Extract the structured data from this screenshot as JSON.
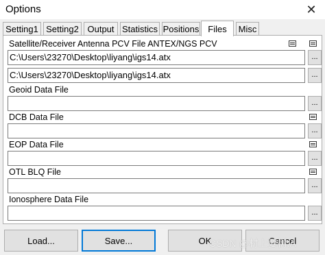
{
  "window": {
    "title": "Options",
    "close_glyph": "✕"
  },
  "tabs": [
    {
      "label": "Setting1",
      "active": false
    },
    {
      "label": "Setting2",
      "active": false
    },
    {
      "label": "Output",
      "active": false
    },
    {
      "label": "Statistics",
      "active": false
    },
    {
      "label": "Positions",
      "active": false
    },
    {
      "label": "Files",
      "active": true
    },
    {
      "label": "Misc",
      "active": false
    }
  ],
  "files": {
    "antenna": {
      "label": "Satellite/Receiver Antenna PCV File ANTEX/NGS PCV",
      "value1": "C:\\Users\\23270\\Desktop\\liyang\\igs14.atx",
      "value2": "C:\\Users\\23270\\Desktop\\liyang\\igs14.atx"
    },
    "geoid": {
      "label": "Geoid Data File",
      "value": ""
    },
    "dcb": {
      "label": "DCB Data File",
      "value": ""
    },
    "eop": {
      "label": "EOP Data File",
      "value": ""
    },
    "otl": {
      "label": "OTL BLQ File",
      "value": ""
    },
    "ionosphere": {
      "label": "Ionosphere Data File",
      "value": ""
    },
    "browse_label": "..."
  },
  "buttons": {
    "load": "Load...",
    "save": "Save...",
    "ok": "OK",
    "cancel": "Cancel"
  },
  "watermark": "CSDN @村上要树.A",
  "icons": {
    "view": "view-file-icon"
  },
  "colors": {
    "focus": "#0078d7",
    "panel": "#ffffff",
    "background": "#f0f0f0"
  }
}
